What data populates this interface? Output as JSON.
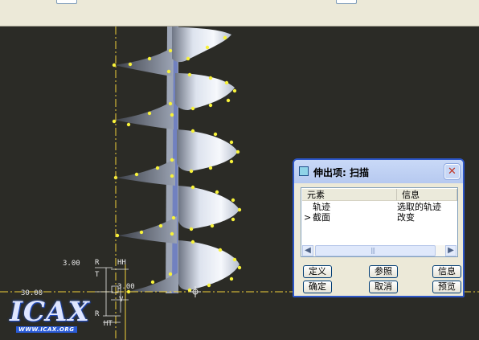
{
  "dimensions": {
    "height_value": "3.00",
    "offset_value": "30.00",
    "width_value": "3.00"
  },
  "labels": {
    "hh": "HH",
    "ht": "HT",
    "t": "T",
    "v": "V",
    "r": "R"
  },
  "logo": {
    "wordmark": "ICAX",
    "url": "WWW.ICAX.ORG"
  },
  "dialog": {
    "title": "伸出项: 扫描",
    "columns": [
      "元素",
      "信息"
    ],
    "rows": [
      {
        "marker": "",
        "element": "轨迹",
        "info": "选取的轨迹"
      },
      {
        "marker": ">",
        "element": "截面",
        "info": "改变"
      }
    ],
    "buttons": {
      "define": "定义",
      "reference": "参照",
      "info": "信息",
      "ok": "确定",
      "cancel": "取消",
      "preview": "预览"
    }
  },
  "colors": {
    "canvas_bg": "#2b2b26",
    "axis": "#f2d23a",
    "vertex_dot": "#f7f23a",
    "dialog_border": "#2c56c8"
  }
}
